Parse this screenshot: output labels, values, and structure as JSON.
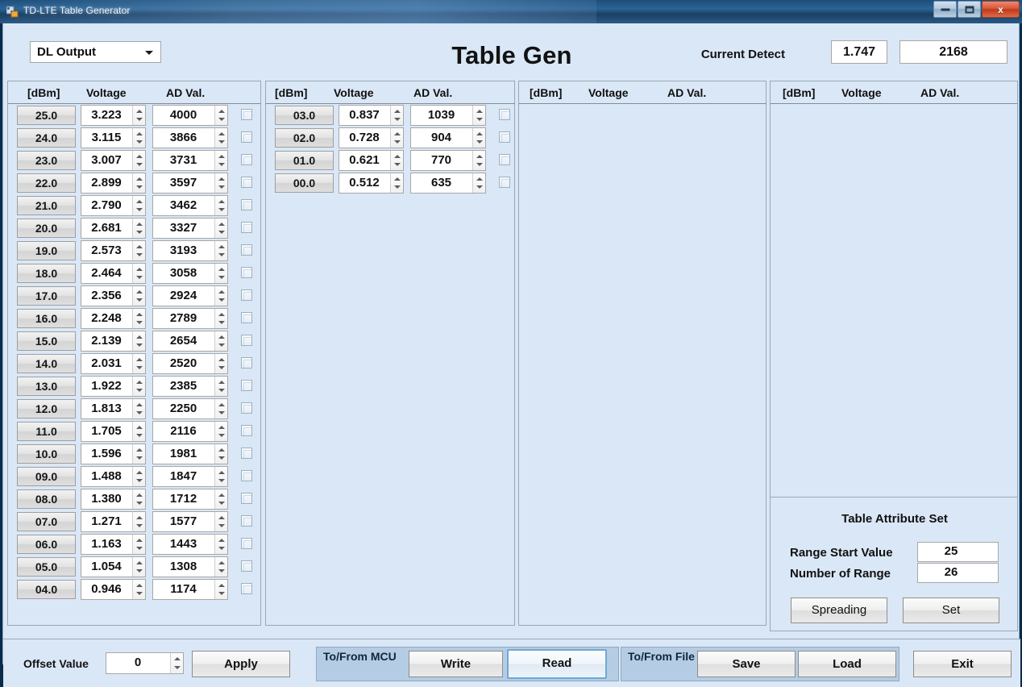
{
  "window": {
    "title": "TD-LTE Table Generator",
    "minimize_label": "Minimize",
    "maximize_label": "Maximize",
    "close_label": "x"
  },
  "header": {
    "mode_select_value": "DL Output",
    "page_title": "Table Gen",
    "current_detect_label": "Current Detect",
    "detect_voltage": "1.747",
    "detect_ad": "2168"
  },
  "columns": {
    "dbm": "[dBm]",
    "voltage": "Voltage",
    "ad": "AD Val."
  },
  "panels": [
    {
      "id": "panel-1",
      "rows": [
        {
          "dbm": "25.0",
          "voltage": "3.223",
          "ad": "4000",
          "checked": false
        },
        {
          "dbm": "24.0",
          "voltage": "3.115",
          "ad": "3866",
          "checked": false
        },
        {
          "dbm": "23.0",
          "voltage": "3.007",
          "ad": "3731",
          "checked": false
        },
        {
          "dbm": "22.0",
          "voltage": "2.899",
          "ad": "3597",
          "checked": false
        },
        {
          "dbm": "21.0",
          "voltage": "2.790",
          "ad": "3462",
          "checked": false
        },
        {
          "dbm": "20.0",
          "voltage": "2.681",
          "ad": "3327",
          "checked": false
        },
        {
          "dbm": "19.0",
          "voltage": "2.573",
          "ad": "3193",
          "checked": false
        },
        {
          "dbm": "18.0",
          "voltage": "2.464",
          "ad": "3058",
          "checked": false
        },
        {
          "dbm": "17.0",
          "voltage": "2.356",
          "ad": "2924",
          "checked": false
        },
        {
          "dbm": "16.0",
          "voltage": "2.248",
          "ad": "2789",
          "checked": false
        },
        {
          "dbm": "15.0",
          "voltage": "2.139",
          "ad": "2654",
          "checked": false
        },
        {
          "dbm": "14.0",
          "voltage": "2.031",
          "ad": "2520",
          "checked": false
        },
        {
          "dbm": "13.0",
          "voltage": "1.922",
          "ad": "2385",
          "checked": false
        },
        {
          "dbm": "12.0",
          "voltage": "1.813",
          "ad": "2250",
          "checked": false
        },
        {
          "dbm": "11.0",
          "voltage": "1.705",
          "ad": "2116",
          "checked": false
        },
        {
          "dbm": "10.0",
          "voltage": "1.596",
          "ad": "1981",
          "checked": false
        },
        {
          "dbm": "09.0",
          "voltage": "1.488",
          "ad": "1847",
          "checked": false
        },
        {
          "dbm": "08.0",
          "voltage": "1.380",
          "ad": "1712",
          "checked": false
        },
        {
          "dbm": "07.0",
          "voltage": "1.271",
          "ad": "1577",
          "checked": false
        },
        {
          "dbm": "06.0",
          "voltage": "1.163",
          "ad": "1443",
          "checked": false
        },
        {
          "dbm": "05.0",
          "voltage": "1.054",
          "ad": "1308",
          "checked": false
        },
        {
          "dbm": "04.0",
          "voltage": "0.946",
          "ad": "1174",
          "checked": false
        }
      ]
    },
    {
      "id": "panel-2",
      "rows": [
        {
          "dbm": "03.0",
          "voltage": "0.837",
          "ad": "1039",
          "checked": false
        },
        {
          "dbm": "02.0",
          "voltage": "0.728",
          "ad": "904",
          "checked": false
        },
        {
          "dbm": "01.0",
          "voltage": "0.621",
          "ad": "770",
          "checked": false
        },
        {
          "dbm": "00.0",
          "voltage": "0.512",
          "ad": "635",
          "checked": false
        }
      ]
    },
    {
      "id": "panel-3",
      "rows": []
    },
    {
      "id": "panel-4",
      "rows": []
    }
  ],
  "attribute_set": {
    "title": "Table Attribute Set",
    "range_start_label": "Range Start Value",
    "range_start_value": "25",
    "number_of_range_label": "Number of Range",
    "number_of_range_value": "26",
    "spreading_label": "Spreading",
    "set_label": "Set"
  },
  "bottom_bar": {
    "offset_label": "Offset Value",
    "offset_value": "0",
    "apply_label": "Apply",
    "mcu_group_label": "To/From MCU",
    "write_label": "Write",
    "read_label": "Read",
    "file_group_label": "To/From File",
    "save_label": "Save",
    "load_label": "Load",
    "exit_label": "Exit"
  },
  "colors": {
    "window_background": "#dae7f6",
    "titlebar": "#2b6496",
    "group_panel": "#b5cde4",
    "focus_ring": "#6fa8d4",
    "close_button": "#da5535"
  }
}
